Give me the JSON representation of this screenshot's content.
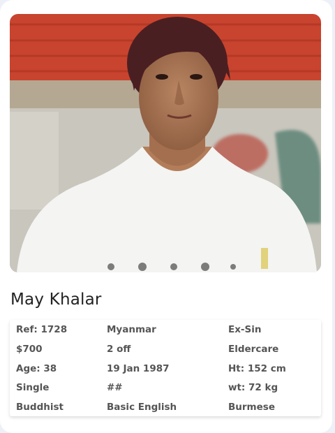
{
  "profile": {
    "name": "May Khalar",
    "photo": "profile-photo"
  },
  "details": {
    "col1": [
      "Ref: 1728",
      "$700",
      "Age: 38",
      "Single",
      "Buddhist"
    ],
    "col2": [
      "Myanmar",
      "2 off",
      "19 Jan 1987",
      "##",
      "Basic English"
    ],
    "col3": [
      "Ex-Sin",
      "Eldercare",
      "Ht: 152 cm",
      "wt: 72 kg",
      "Burmese"
    ]
  }
}
